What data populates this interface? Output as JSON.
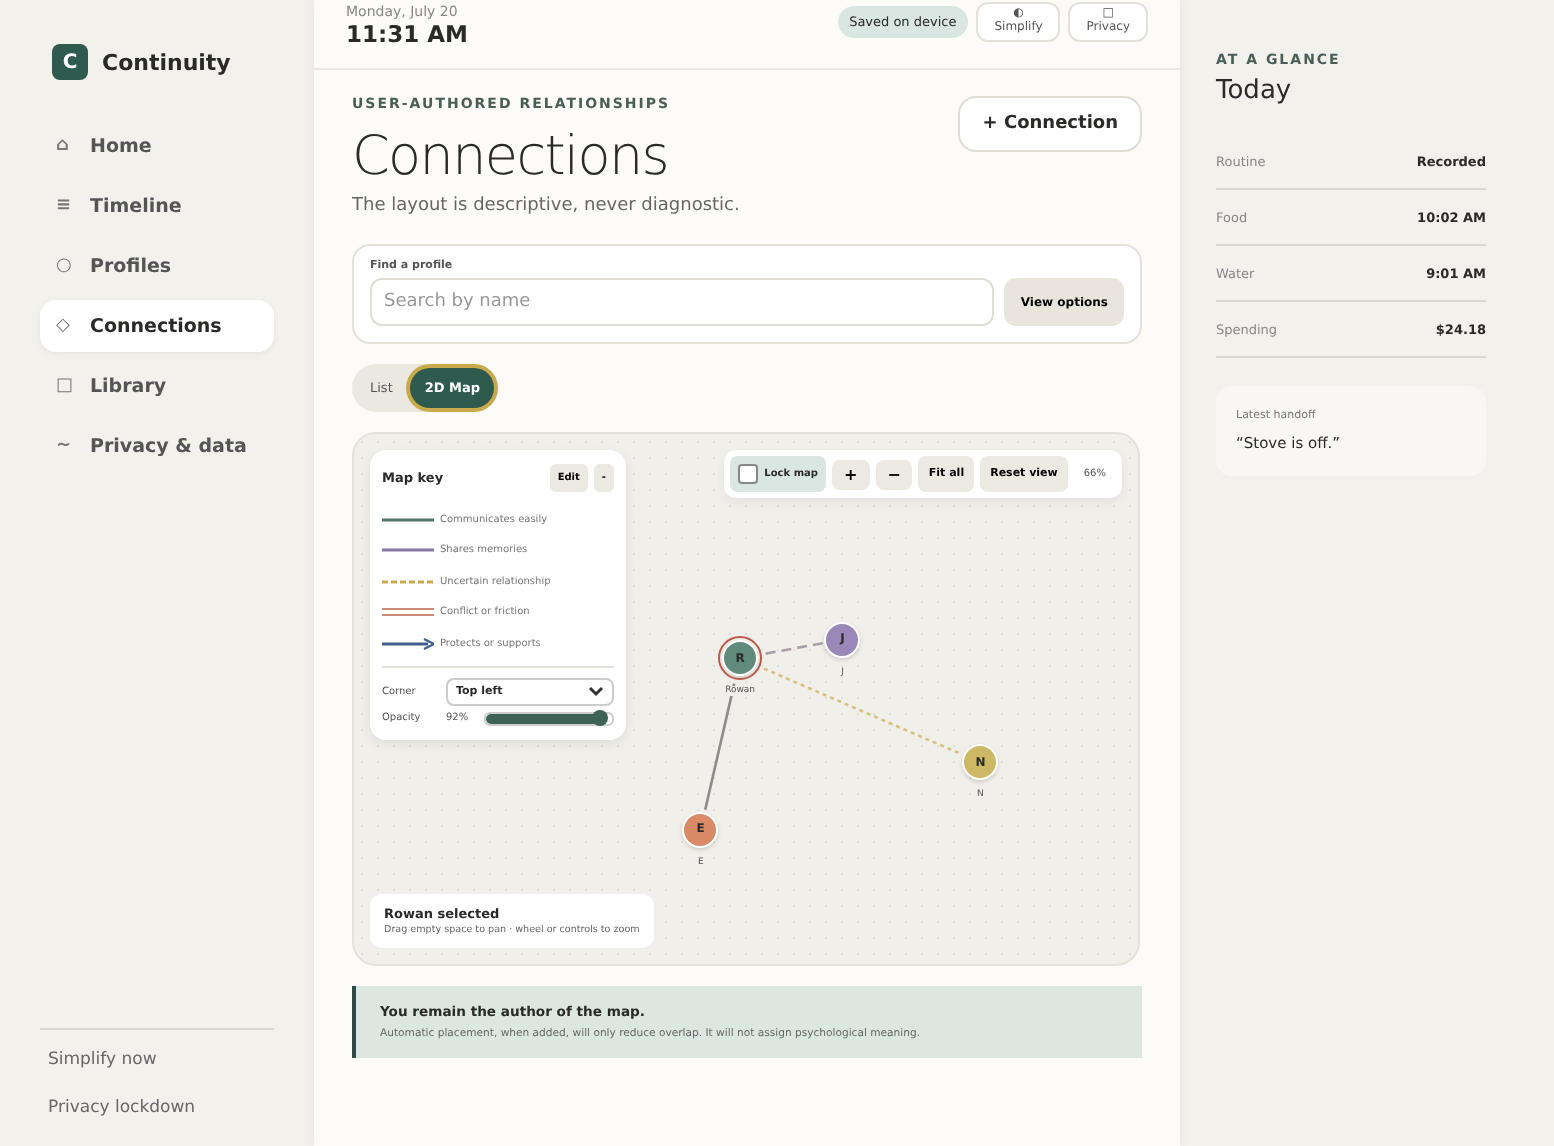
{
  "app": {
    "logo": "C",
    "name": "Continuity"
  },
  "nav": [
    {
      "icon": "⌂",
      "label": "Home",
      "selected": false
    },
    {
      "icon": "≡",
      "label": "Timeline",
      "selected": false
    },
    {
      "icon": "○",
      "label": "Profiles",
      "selected": false
    },
    {
      "icon": "◇",
      "label": "Connections",
      "selected": true
    },
    {
      "icon": "□",
      "label": "Library",
      "selected": false
    },
    {
      "icon": "~",
      "label": "Privacy & data",
      "selected": false
    }
  ],
  "sidebar_footer": [
    "Simplify now",
    "Privacy lockdown"
  ],
  "header": {
    "date": "Monday, July 20",
    "time": "11:31 AM",
    "badge": "Saved on device",
    "buttons": [
      {
        "icon": "◐",
        "label": "Simplify"
      },
      {
        "icon": "□",
        "label": "Privacy"
      }
    ]
  },
  "page": {
    "eyebrow": "USER-AUTHORED RELATIONSHIPS",
    "title": "Connections",
    "subtitle": "The layout is descriptive, never diagnostic.",
    "action": "+ Connection"
  },
  "search": {
    "label": "Find a profile",
    "placeholder": "Search by name",
    "button": "View options"
  },
  "views": [
    {
      "label": "List",
      "selected": false
    },
    {
      "label": "2D Map",
      "selected": true
    }
  ],
  "map_key": {
    "title": "Map key",
    "edit": "Edit",
    "collapse": "-",
    "items": [
      {
        "kind": "solid",
        "label": "Communicates easily",
        "color": "#4f7468"
      },
      {
        "kind": "solid",
        "label": "Shares memories",
        "color": "#8a78a8"
      },
      {
        "kind": "dashed",
        "label": "Uncertain relationship",
        "color": "#c9a94a"
      },
      {
        "kind": "double",
        "label": "Conflict or friction",
        "color": "#c98a7a"
      },
      {
        "kind": "arrow",
        "label": "Protects or supports",
        "color": "#3f5f8a"
      }
    ],
    "corner_label": "Corner",
    "corner": "Top left",
    "opacity_label": "Opacity",
    "opacity": "92%",
    "level": 0.92
  },
  "toolbar": {
    "lock_label": "Lock map",
    "locked": false,
    "zoom_in": "+",
    "zoom_out": "−",
    "fit": "Fit all",
    "reset": "Reset view",
    "zoom": "66%"
  },
  "nodes": [
    {
      "initial": "R",
      "name": "Rowan",
      "color": "#5f8a7c",
      "selected": true
    },
    {
      "initial": "J",
      "name": "J",
      "color": "#9a88b8",
      "selected": false,
      "link": {
        "kind": "dashed",
        "color": "#a8a0a8"
      }
    },
    {
      "initial": "N",
      "name": "N",
      "color": "#cdb866",
      "selected": false,
      "link": {
        "kind": "dotted",
        "color": "#d8c080"
      }
    },
    {
      "initial": "E",
      "name": "E",
      "color": "#d98a66",
      "selected": false,
      "link": {
        "kind": "solid",
        "color": "#8c8c88"
      }
    }
  ],
  "selection": {
    "title": "Rowan selected",
    "hint": "Drag empty space to pan · wheel or controls to zoom"
  },
  "note": {
    "title": "You remain the author of the map.",
    "body": "Automatic placement, when added, will only reduce overlap. It will not assign psychological meaning."
  },
  "glance": {
    "eyebrow": "AT A GLANCE",
    "title": "Today",
    "rows": [
      {
        "label": "Routine",
        "value": "Recorded"
      },
      {
        "label": "Food",
        "value": "10:02 AM"
      },
      {
        "label": "Water",
        "value": "9:01 AM"
      },
      {
        "label": "Spending",
        "value": "$24.18"
      }
    ],
    "handoff_label": "Latest handoff",
    "handoff": "“Stove is off.”"
  }
}
